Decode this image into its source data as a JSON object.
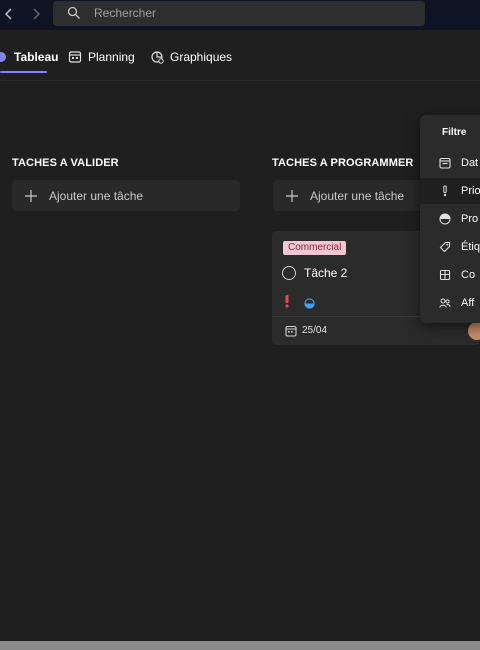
{
  "search": {
    "placeholder": "Rechercher"
  },
  "tabs": [
    {
      "label": "Tableau",
      "active": true
    },
    {
      "label": "Planning",
      "active": false
    },
    {
      "label": "Graphiques",
      "active": false
    }
  ],
  "columns": [
    {
      "title": "TACHES A VALIDER",
      "add_label": "Ajouter une tâche"
    },
    {
      "title": "TACHES A PROGRAMMER",
      "add_label": "Ajouter une tâche"
    }
  ],
  "card": {
    "label": "Commercial",
    "title": "Tâche 2",
    "due_date": "25/04",
    "priority": "urgent",
    "progress": "in-progress"
  },
  "filter_menu": {
    "title": "Filtre",
    "items": [
      {
        "label": "Dat",
        "icon": "calendar-icon"
      },
      {
        "label": "Prio",
        "icon": "priority-icon",
        "active": true
      },
      {
        "label": "Pro",
        "icon": "progress-icon"
      },
      {
        "label": "Étiq",
        "icon": "label-tag-icon"
      },
      {
        "label": "Co",
        "icon": "bucket-icon"
      },
      {
        "label": "Aff",
        "icon": "people-icon"
      }
    ]
  },
  "colors": {
    "accent": "#7f85f5",
    "label_bg": "#f4c6d1",
    "label_text": "#8a2a3e",
    "urgent": "#e8455a",
    "progress": "#479ef5"
  }
}
